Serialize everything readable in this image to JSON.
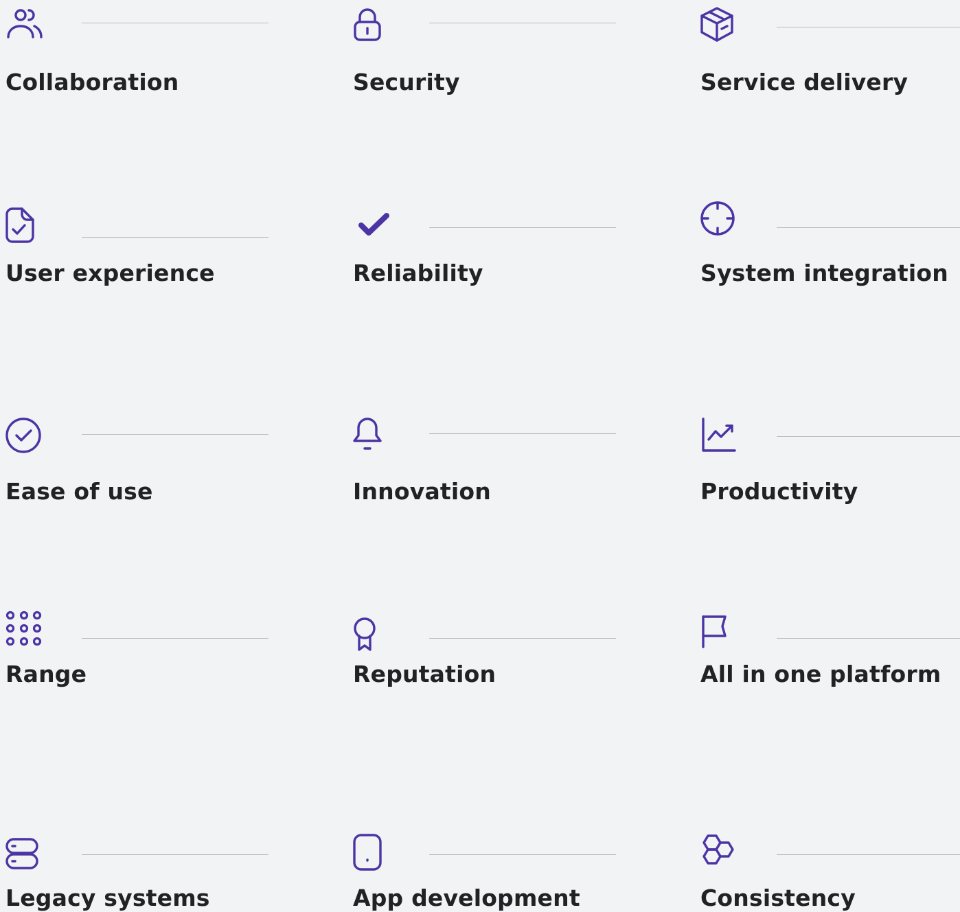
{
  "accent_color": "#4b34a4",
  "features": [
    {
      "label": "Collaboration",
      "icon": "users-icon"
    },
    {
      "label": "Security",
      "icon": "lock-icon"
    },
    {
      "label": "Service delivery",
      "icon": "package-icon"
    },
    {
      "label": "User experience",
      "icon": "file-check-icon"
    },
    {
      "label": "Reliability",
      "icon": "checkmark-icon"
    },
    {
      "label": "System integration",
      "icon": "crosshair-icon"
    },
    {
      "label": "Ease of use",
      "icon": "circle-check-icon"
    },
    {
      "label": "Innovation",
      "icon": "bell-icon"
    },
    {
      "label": "Productivity",
      "icon": "chart-line-icon"
    },
    {
      "label": "Range",
      "icon": "dots-grid-icon"
    },
    {
      "label": "Reputation",
      "icon": "award-icon"
    },
    {
      "label": "All in one platform",
      "icon": "flag-icon"
    },
    {
      "label": "Legacy systems",
      "icon": "server-icon"
    },
    {
      "label": "App development",
      "icon": "mobile-icon"
    },
    {
      "label": "Consistency",
      "icon": "hexagons-icon"
    }
  ]
}
